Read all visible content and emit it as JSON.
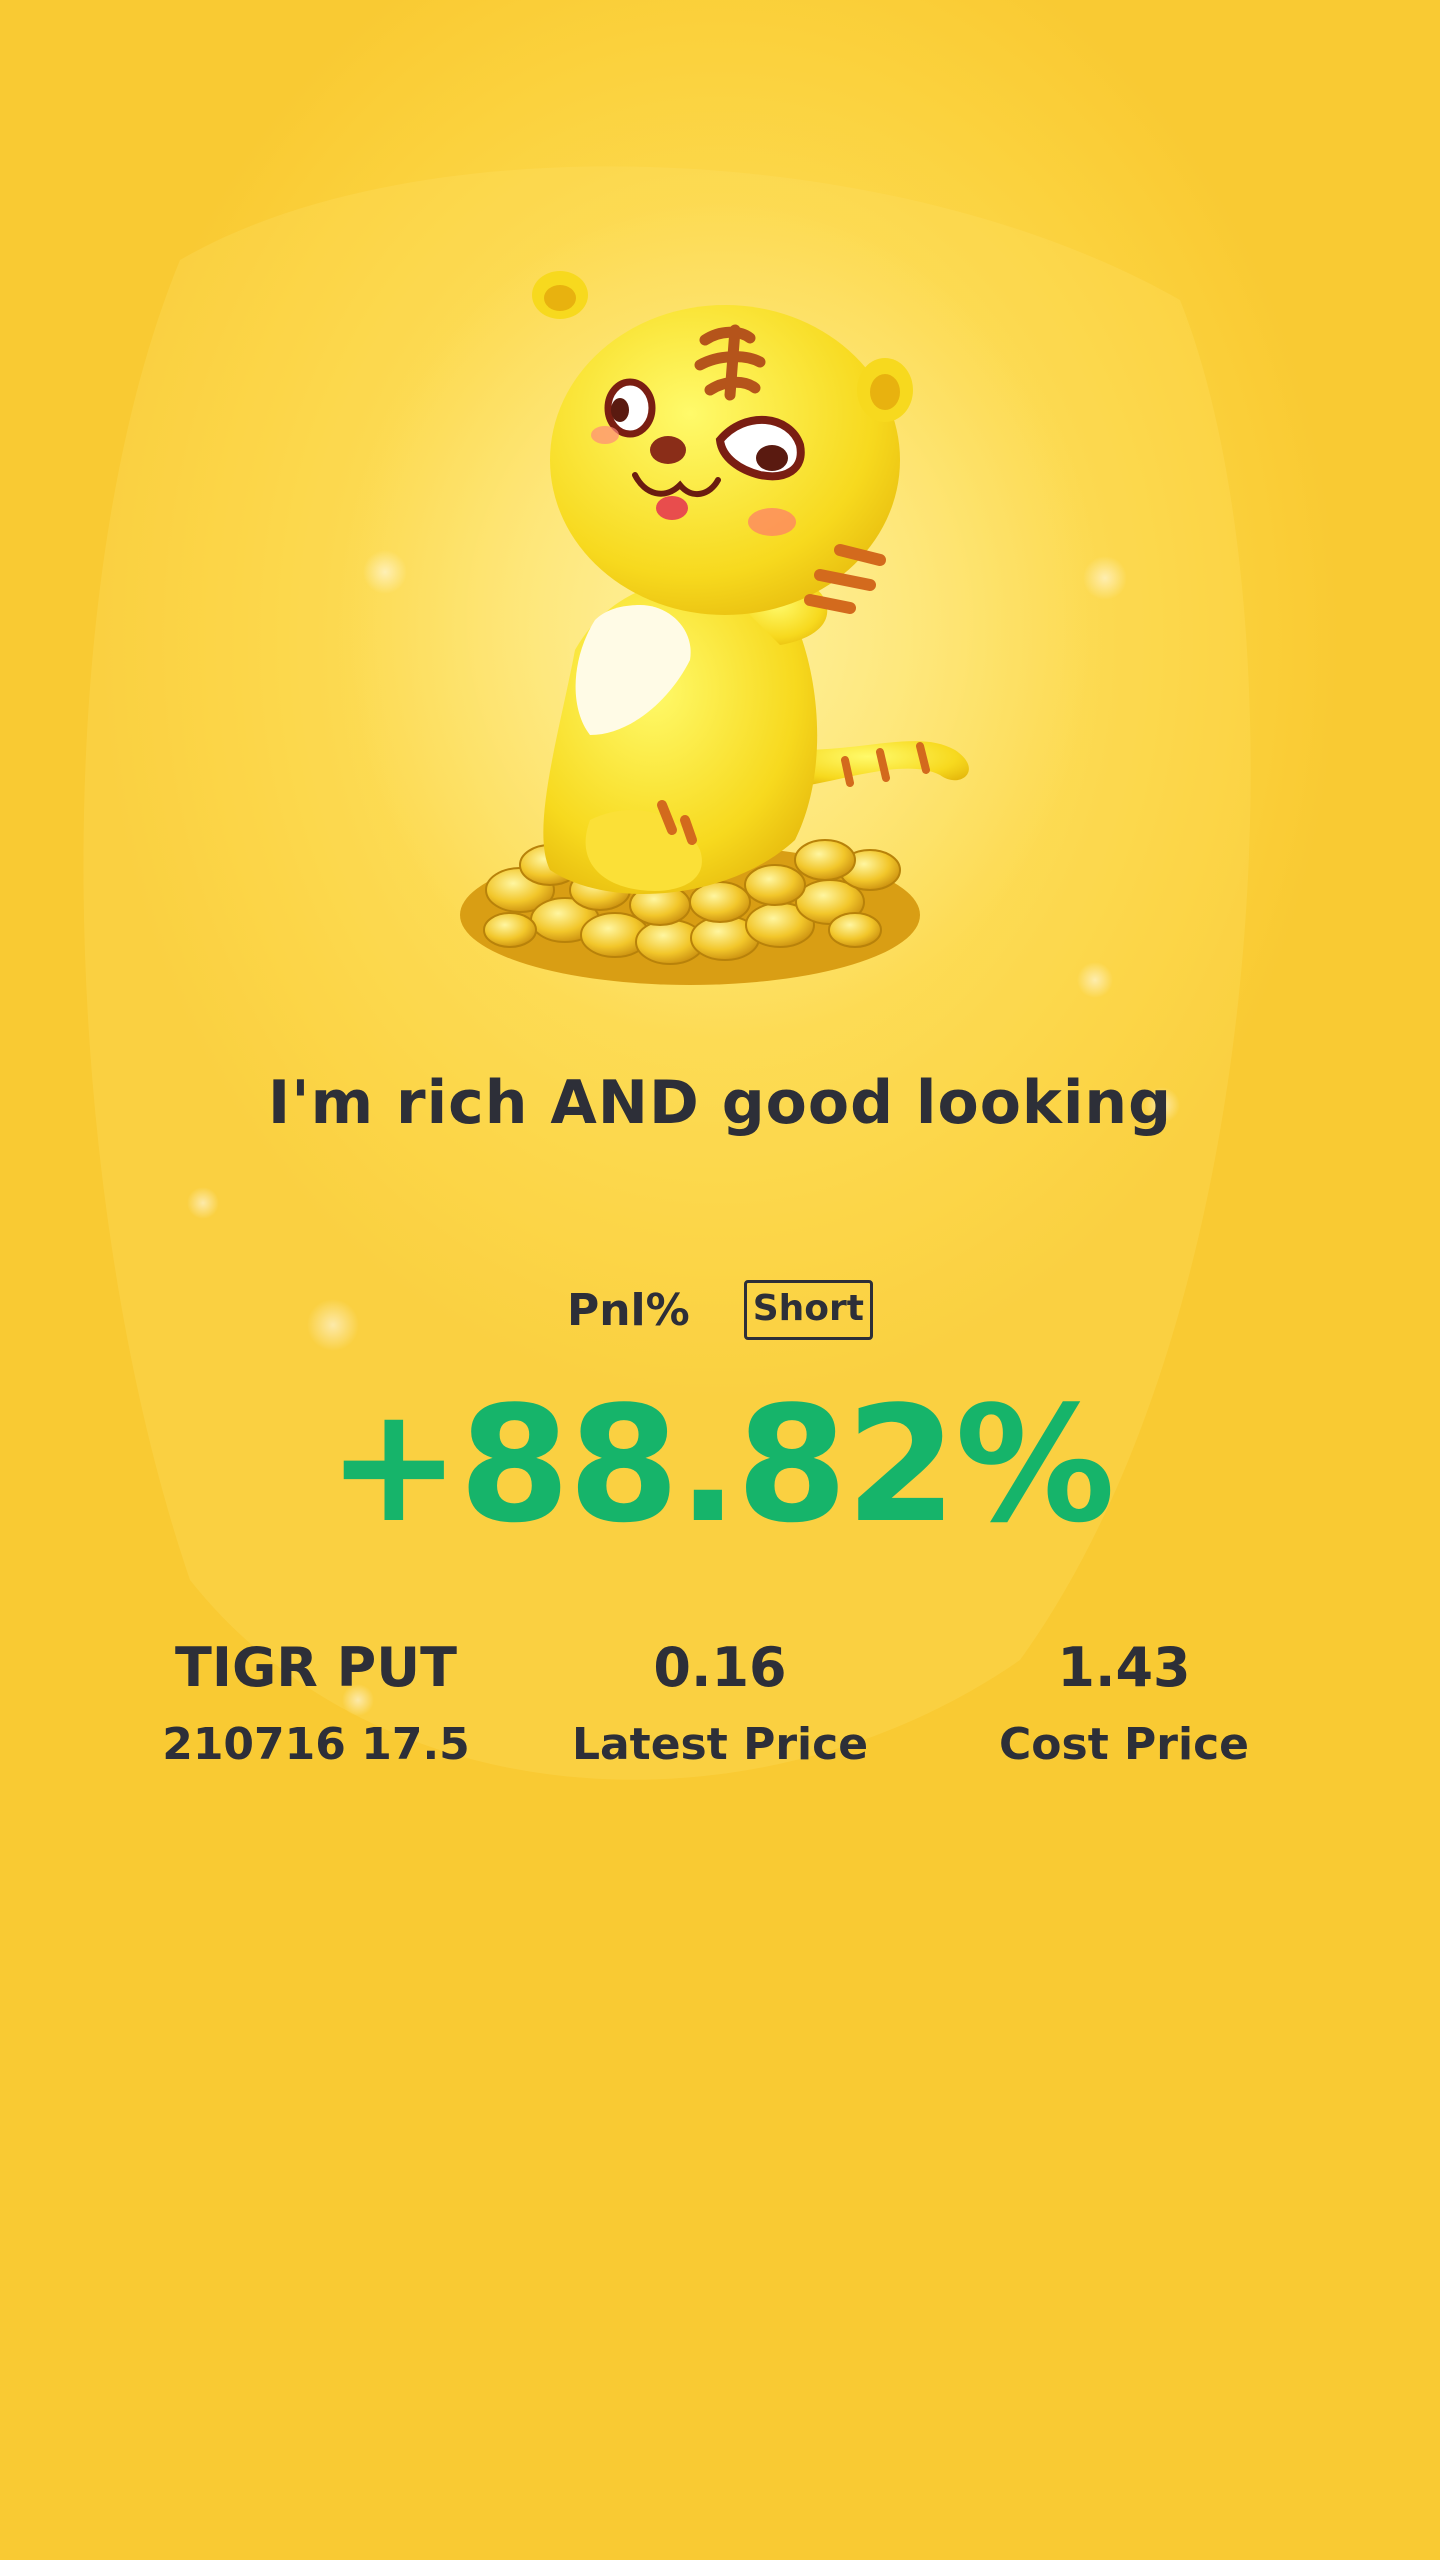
{
  "tagline": "I'm rich AND good looking",
  "pnl": {
    "label": "Pnl%",
    "direction_badge": "Short",
    "value": "+88.82%"
  },
  "stats": {
    "symbol_line1": "TIGR PUT",
    "symbol_line2": "210716 17.5",
    "latest_price": "0.16",
    "latest_price_label": "Latest Price",
    "cost_price": "1.43",
    "cost_price_label": "Cost Price"
  },
  "colors": {
    "background": "#fbd13c",
    "profit_green": "#16b46a",
    "text_dark": "#2d2f38"
  },
  "icons": {
    "mascot": "tiger-mascot-on-coins-icon"
  }
}
